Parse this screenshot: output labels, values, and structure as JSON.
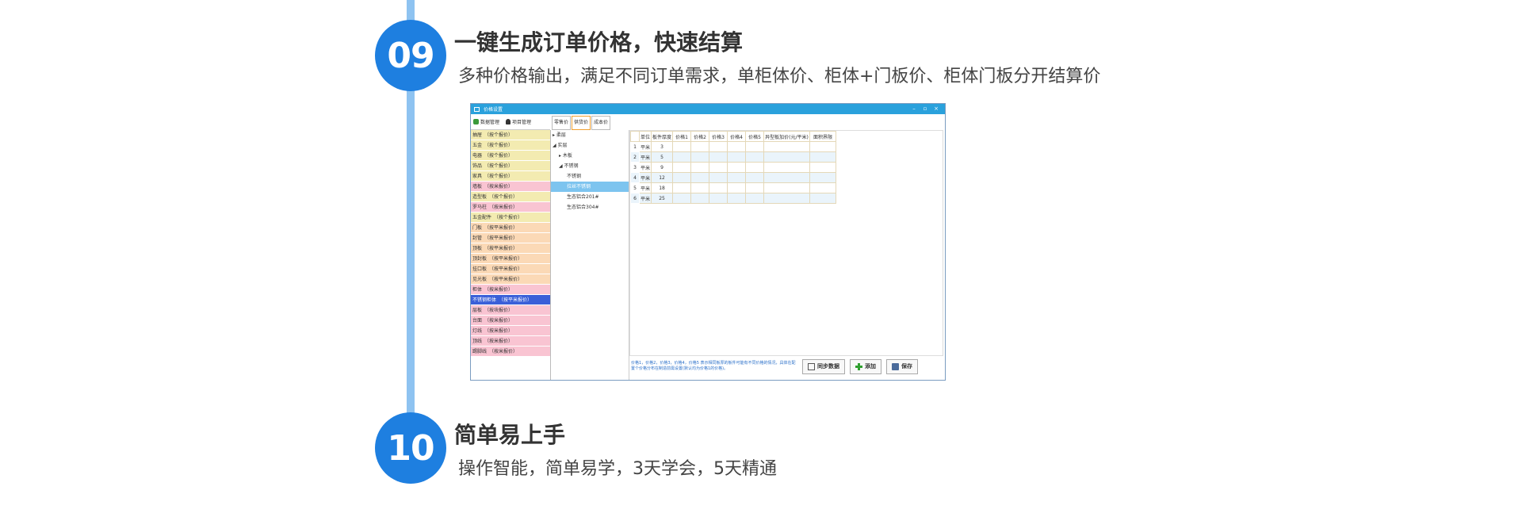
{
  "section09": {
    "number": "09",
    "title": "一键生成订单价格，快速结算",
    "subtitle": "多种价格输出，满足不同订单需求，单柜体价、柜体+门板价、柜体门板分开结算价"
  },
  "section10": {
    "number": "10",
    "title": "简单易上手",
    "subtitle": "操作智能，简单易学，3天学会，5天精通"
  },
  "window": {
    "title": "价格设置",
    "controls": [
      "–",
      "▫",
      "×"
    ],
    "toolbar": {
      "data_mgmt": "数据管理",
      "item_mgmt": "项目管理"
    },
    "categories": [
      {
        "label": "抽屉　（按个报价）",
        "color": "#f3ebb1"
      },
      {
        "label": "五金　（按个报价）",
        "color": "#f3ebb1"
      },
      {
        "label": "电器　（按个报价）",
        "color": "#f3ebb1"
      },
      {
        "label": "饰品　（按个报价）",
        "color": "#f3ebb1"
      },
      {
        "label": "家具　（按个报价）",
        "color": "#f3ebb1"
      },
      {
        "label": "墙板　（按米报价）",
        "color": "#f9c4d2"
      },
      {
        "label": "造型板　（按个报价）",
        "color": "#f3ebb1"
      },
      {
        "label": "罗马柱　（按米报价）",
        "color": "#f9c4d2"
      },
      {
        "label": "五金配件　（按个报价）",
        "color": "#f3ebb1"
      },
      {
        "label": "门板　（按平米报价）",
        "color": "#fbd9b6"
      },
      {
        "label": "封管　（按平米报价）",
        "color": "#fbd9b6"
      },
      {
        "label": "顶板　（按平米报价）",
        "color": "#fbd9b6"
      },
      {
        "label": "顶封板　（按平米报价）",
        "color": "#fbd9b6"
      },
      {
        "label": "挂口板　（按平米报价）",
        "color": "#fbd9b6"
      },
      {
        "label": "见光板　（按平米报价）",
        "color": "#fbd9b6"
      },
      {
        "label": "柜体　（按米报价）",
        "color": "#f9c4d2"
      },
      {
        "label": "不锈钢柜体　（按平米报价）",
        "color": "#3a5fd8",
        "text": "#ffffff"
      },
      {
        "label": "层板　（按块报价）",
        "color": "#f9c4d2"
      },
      {
        "label": "台面　（按米报价）",
        "color": "#f9c4d2"
      },
      {
        "label": "灯线　（按米报价）",
        "color": "#f9c4d2"
      },
      {
        "label": "顶线　（按米报价）",
        "color": "#f9c4d2"
      },
      {
        "label": "踢脚线　（按米报价）",
        "color": "#f9c4d2"
      }
    ],
    "tabs": [
      "零售价",
      "供货价",
      "成本价"
    ],
    "tree": [
      {
        "label": "▸ 柔层",
        "indent": 2,
        "selected": false
      },
      {
        "label": "◢ 实层",
        "indent": 2,
        "selected": false
      },
      {
        "label": "▸ 木板",
        "indent": 10,
        "selected": false
      },
      {
        "label": "◢ 不锈钢",
        "indent": 10,
        "selected": false
      },
      {
        "label": "不锈钢",
        "indent": 20,
        "selected": false
      },
      {
        "label": "拉丝不锈钢",
        "indent": 20,
        "selected": true
      },
      {
        "label": "生态铝合201#",
        "indent": 20,
        "selected": false
      },
      {
        "label": "生态铝合304#",
        "indent": 20,
        "selected": false
      }
    ],
    "table": {
      "headers": [
        "单位",
        "板件厚度",
        "价格1",
        "价格2",
        "价格3",
        "价格4",
        "价格5",
        "异型板加价(元/平米)",
        "面积界限"
      ],
      "rows": [
        {
          "n": "1",
          "unit": "平米",
          "thickness": "3"
        },
        {
          "n": "2",
          "unit": "平米",
          "thickness": "5"
        },
        {
          "n": "3",
          "unit": "平米",
          "thickness": "9"
        },
        {
          "n": "4",
          "unit": "平米",
          "thickness": "12"
        },
        {
          "n": "5",
          "unit": "平米",
          "thickness": "18"
        },
        {
          "n": "6",
          "unit": "平米",
          "thickness": "25"
        }
      ]
    },
    "note": "价格1，价格2，价格3，价格4，价格5 表示相同板厚的板件可能有不同价格的情况，具体在配置个价格分布在制造前需设置(默认均为价格1的价格)。",
    "buttons": {
      "sync": "同步数据",
      "add": "添加",
      "save": "保存"
    }
  },
  "colors": {
    "badge": "#1e7fe0",
    "timeline": "#8ec3f1",
    "titlebar": "#2aa1dc"
  }
}
